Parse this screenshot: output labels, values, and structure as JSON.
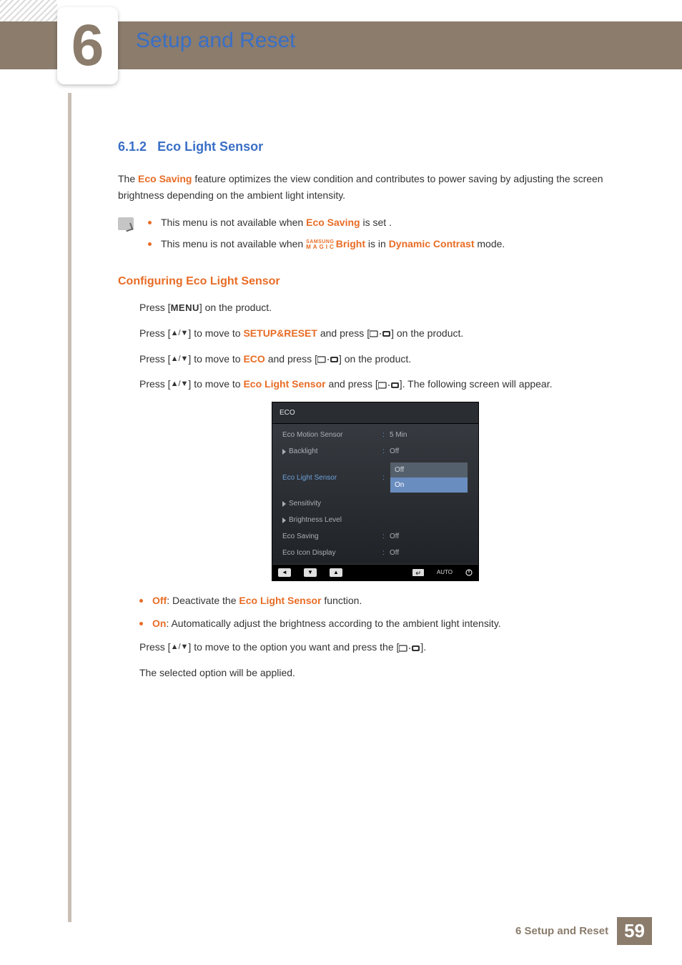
{
  "chapter": {
    "number": "6",
    "title": "Setup and Reset"
  },
  "section": {
    "number": "6.1.2",
    "title": "Eco Light Sensor"
  },
  "intro": {
    "pre": "The ",
    "link": "Eco Saving",
    "post": " feature optimizes the view condition and contributes to power saving by adjusting the screen brightness depending on the ambient light intensity."
  },
  "notes": {
    "n1a": "This menu is not available when ",
    "n1b": "Eco Saving",
    "n1c": " is set .",
    "n2a": "This menu is not available when ",
    "n2_magic_top": "SAMSUNG",
    "n2_magic_bot": "MAGIC",
    "n2_bright": "Bright",
    "n2b": " is in ",
    "n2c": "Dynamic Contrast",
    "n2d": " mode."
  },
  "sub": "Configuring Eco Light Sensor",
  "steps": {
    "s1a": "Press [",
    "s1_menu": "MENU",
    "s1b": "] on the product.",
    "s2a": "Press [",
    "s2b": "] to move to ",
    "s2_link": "SETUP&RESET",
    "s2c": " and press [",
    "s2d": "] on the product.",
    "s3a": "Press [",
    "s3b": "] to move to ",
    "s3_link": "ECO",
    "s3c": " and press [",
    "s3d": "] on the product.",
    "s4a": "Press [",
    "s4b": "] to move to ",
    "s4_link": "Eco Light Sensor",
    "s4c": " and press [",
    "s4d": "]. The following screen will appear."
  },
  "osd": {
    "title": "ECO",
    "rows": {
      "r1": {
        "label": "Eco Motion Sensor",
        "val": "5 Min"
      },
      "r2": {
        "label": "Backlight",
        "val": "Off"
      },
      "r3": {
        "label": "Eco Light Sensor",
        "opt1": "Off",
        "opt2": "On"
      },
      "r4": {
        "label": "Sensitivity",
        "val": ""
      },
      "r5": {
        "label": "Brightness Level",
        "val": ""
      },
      "r6": {
        "label": "Eco Saving",
        "val": "Off"
      },
      "r7": {
        "label": "Eco Icon Display",
        "val": "Off"
      }
    },
    "footer": {
      "auto": "AUTO"
    }
  },
  "options": {
    "off_lbl": "Off",
    "off_txt": ": Deactivate the ",
    "off_link": "Eco Light Sensor",
    "off_end": " function.",
    "on_lbl": "On",
    "on_txt": ": Automatically adjust the brightness according to the ambient light intensity."
  },
  "tail": {
    "t1a": "Press [",
    "t1b": "] to move to the option you want and press the [",
    "t1c": "].",
    "t2": "The selected option will be applied."
  },
  "footer": {
    "text": "6 Setup and Reset",
    "page": "59"
  }
}
